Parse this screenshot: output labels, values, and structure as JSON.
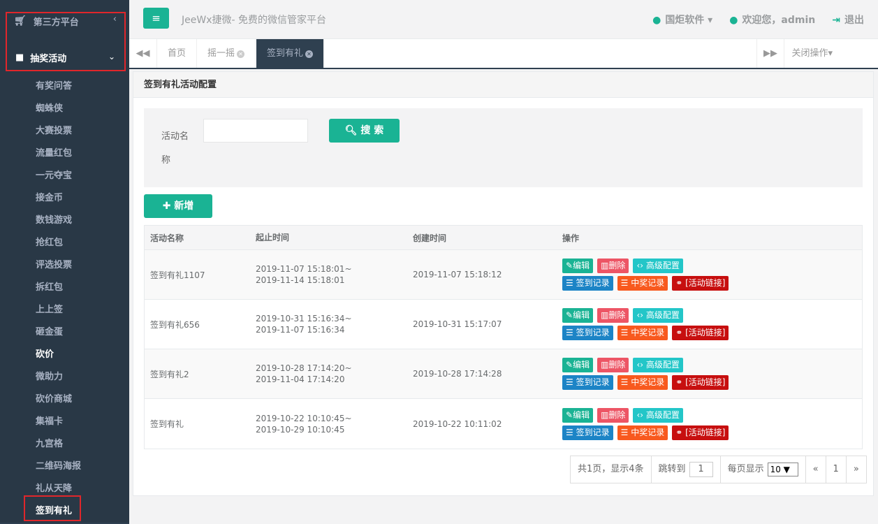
{
  "sidebar": {
    "top_label": "第三方平台",
    "active_label": "抽奖活动",
    "items": [
      {
        "label": "有奖问答",
        "bright": false
      },
      {
        "label": "蜘蛛侠",
        "bright": false
      },
      {
        "label": "大赛投票",
        "bright": false
      },
      {
        "label": "流量红包",
        "bright": false
      },
      {
        "label": "一元夺宝",
        "bright": false
      },
      {
        "label": "接金币",
        "bright": false
      },
      {
        "label": "数钱游戏",
        "bright": false
      },
      {
        "label": "抢红包",
        "bright": false
      },
      {
        "label": "评选投票",
        "bright": false
      },
      {
        "label": "拆红包",
        "bright": false
      },
      {
        "label": "上上签",
        "bright": false
      },
      {
        "label": "砸金蛋",
        "bright": false
      },
      {
        "label": "砍价",
        "bright": true
      },
      {
        "label": "微助力",
        "bright": false
      },
      {
        "label": "砍价商城",
        "bright": false
      },
      {
        "label": "集福卡",
        "bright": false
      },
      {
        "label": "九宫格",
        "bright": false
      },
      {
        "label": "二维码海报",
        "bright": false
      },
      {
        "label": "礼从天降",
        "bright": false
      },
      {
        "label": "签到有礼",
        "bright": true
      }
    ]
  },
  "header": {
    "brand": "JeeWx捷微- 免费的微信管家平台",
    "org": "国炬软件",
    "welcome": "欢迎您，admin",
    "logout": "退出"
  },
  "tabs": {
    "items": [
      "首页",
      "摇一摇",
      "签到有礼"
    ],
    "close_ops": "关闭操作"
  },
  "panel": {
    "title": "签到有礼活动配置",
    "search_label": "活动名称",
    "search_value": "",
    "search_button": "搜 索",
    "add_button": "新增"
  },
  "table": {
    "headers": [
      "活动名称",
      "起止时间",
      "创建时间",
      "操作"
    ],
    "rows": [
      {
        "name": "签到有礼1107",
        "start": "2019-11-07 15:18:01~",
        "end": "2019-11-14 15:18:01",
        "created": "2019-11-07 15:18:12"
      },
      {
        "name": "签到有礼656",
        "start": "2019-10-31 15:16:34~",
        "end": "2019-11-07 15:16:34",
        "created": "2019-10-31 15:17:07"
      },
      {
        "name": "签到有礼2",
        "start": "2019-10-28 17:14:20~",
        "end": "2019-11-04 17:14:20",
        "created": "2019-10-28 17:14:28"
      },
      {
        "name": "签到有礼",
        "start": "2019-10-22 10:10:45~",
        "end": "2019-10-29 10:10:45",
        "created": "2019-10-22 10:11:02"
      }
    ],
    "ops": {
      "edit": "编辑",
      "delete": "删除",
      "advanced": "高级配置",
      "sign_records": "签到记录",
      "win_records": "中奖记录",
      "link": "[活动链接]"
    }
  },
  "pager": {
    "summary": "共1页，显示4条",
    "jump_label": "跳转到",
    "jump_value": "1",
    "per_page_label": "每页显示",
    "per_page_value": "10",
    "prev": "«",
    "page": "1",
    "next": "»"
  },
  "colors": {
    "sidebar": "#2f4050",
    "primary": "#1ab394",
    "danger": "#ed5565",
    "info": "#23c6c8",
    "blue": "#1c84c6",
    "orange": "#f8591e",
    "darkred": "#c70f0f",
    "highlight_box": "#e0262b"
  }
}
